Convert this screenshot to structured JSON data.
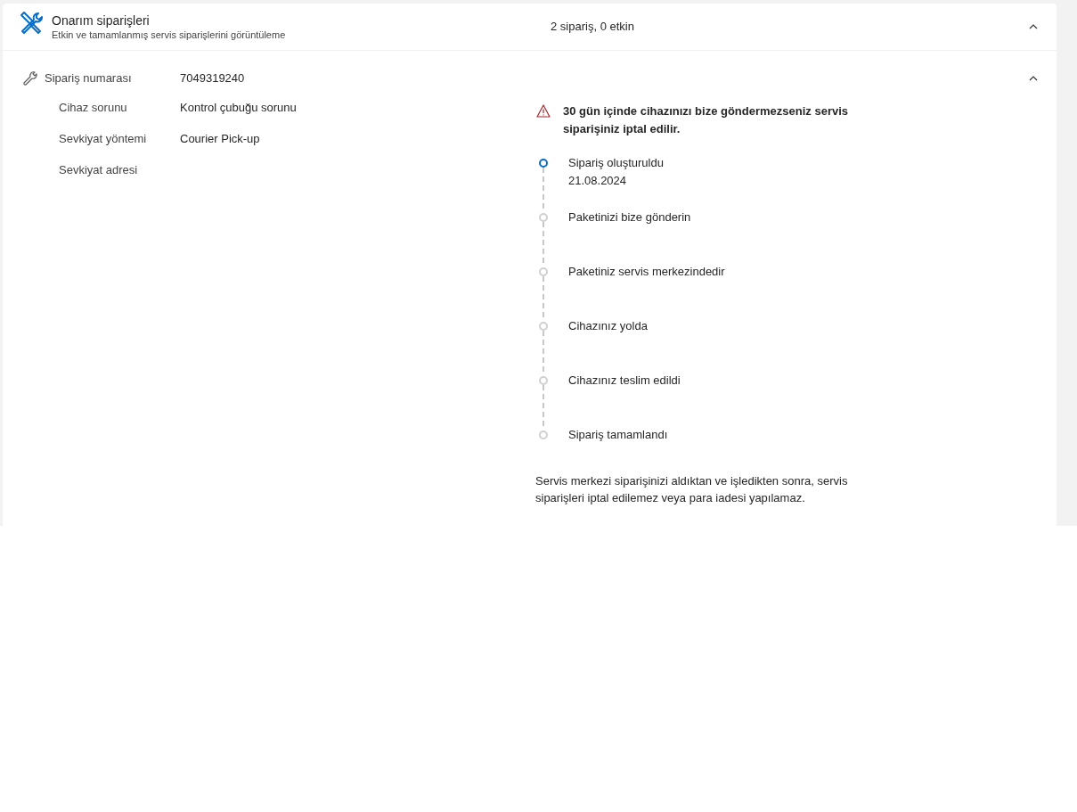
{
  "header": {
    "title": "Onarım siparişleri",
    "subtitle": "Etkin ve tamamlanmış servis siparişlerini görüntüleme",
    "summary": "2 sipariş, 0 etkin",
    "expanded": true
  },
  "order": {
    "label": "Sipariş numarası",
    "number": "7049319240",
    "expanded": true,
    "details": [
      {
        "label": "Cihaz sorunu",
        "value": "Kontrol çubuğu sorunu"
      },
      {
        "label": "Sevkiyat yöntemi",
        "value": "Courier Pick-up"
      },
      {
        "label": "Sevkiyat adresi"
      }
    ],
    "warning": "30 gün içinde cihazınızı bize göndermezseniz servis siparişiniz iptal edilir.",
    "steps": [
      {
        "label": "Sipariş oluşturuldu",
        "date": "21.08.2024",
        "active": true
      },
      {
        "label": "Paketinizi bize gönderin",
        "active": false
      },
      {
        "label": "Paketiniz servis merkezindedir",
        "active": false
      },
      {
        "label": "Cihazınız yolda",
        "active": false
      },
      {
        "label": "Cihazınız teslim edildi",
        "active": false
      },
      {
        "label": "Sipariş tamamlandı",
        "active": false
      }
    ],
    "note": "Servis merkezi siparişinizi aldıktan ve işledikten sonra, servis siparişleri iptal edilemez veya para iadesi yapılamaz."
  }
}
